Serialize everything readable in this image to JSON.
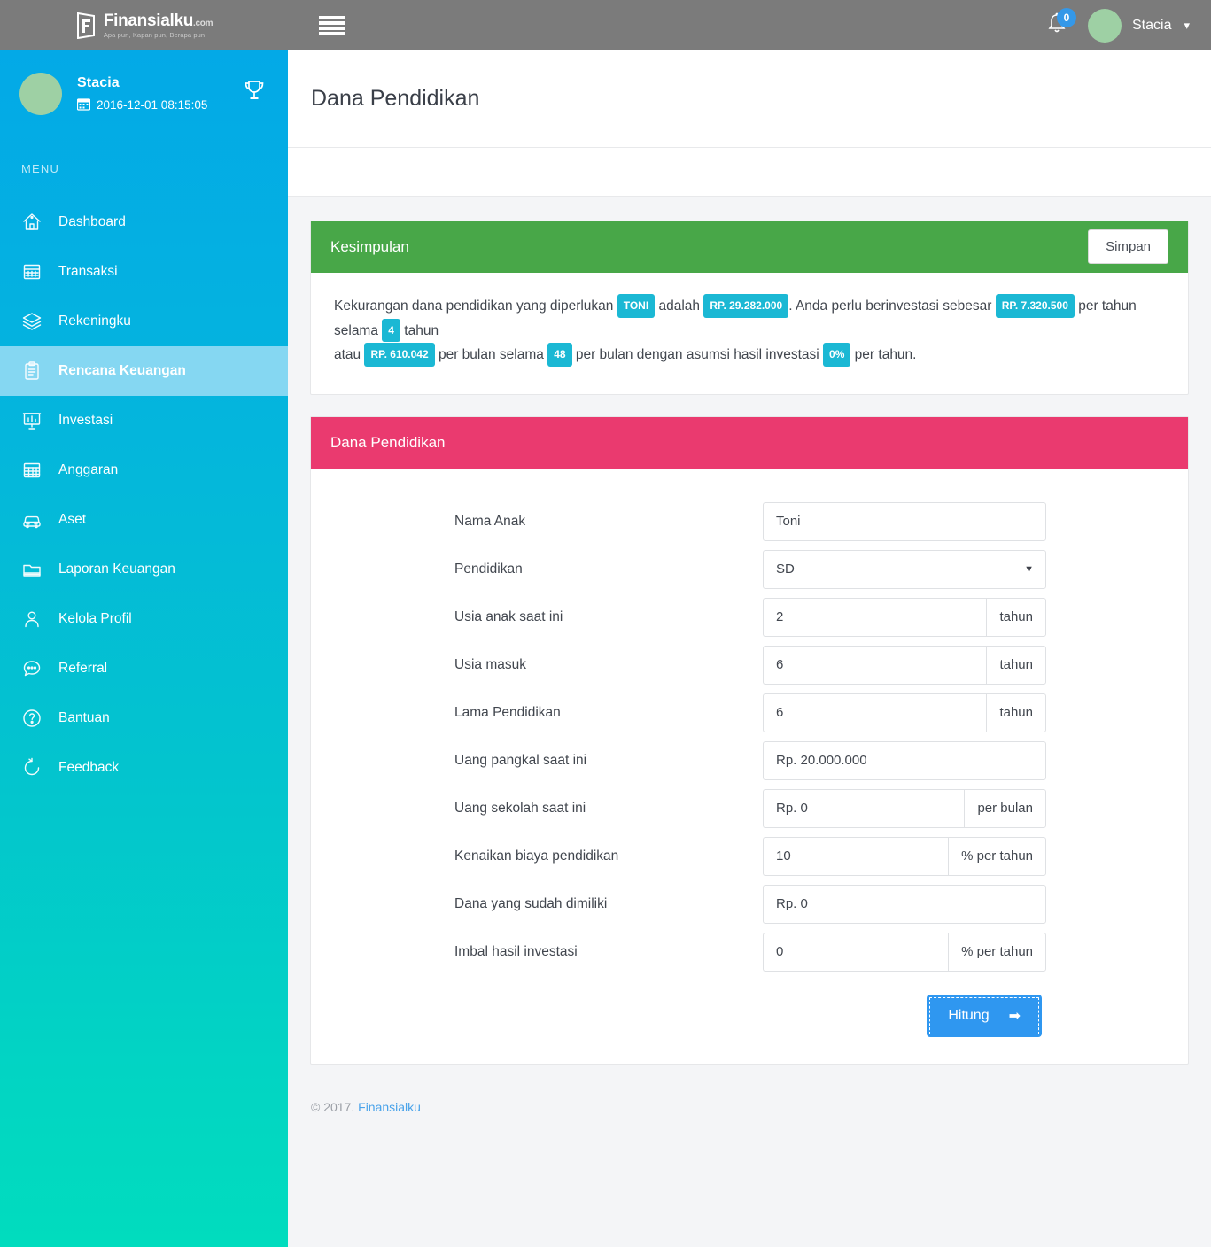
{
  "topbar": {
    "logo_title": "Finansialku",
    "logo_suffix": ".com",
    "logo_tagline": "Apa pun, Kapan pun, Berapa pun",
    "menu_toggle_name": "hamburger-menu",
    "notification_count": "0",
    "user_name": "Stacia",
    "caret": "⌄"
  },
  "sidebar": {
    "user_name": "Stacia",
    "user_datetime": "2016-12-01 08:15:05",
    "menu_label": "MENU",
    "items": [
      {
        "label": "Dashboard",
        "icon": "home-icon",
        "key": "dashboard",
        "active": false
      },
      {
        "label": "Transaksi",
        "icon": "calendar-icon",
        "key": "transaksi",
        "active": false
      },
      {
        "label": "Rekeningku",
        "icon": "layers-icon",
        "key": "rekeningku",
        "active": false
      },
      {
        "label": "Rencana Keuangan",
        "icon": "clipboard-icon",
        "key": "rencana-keuangan",
        "active": true
      },
      {
        "label": "Investasi",
        "icon": "chart-board-icon",
        "key": "investasi",
        "active": false
      },
      {
        "label": "Anggaran",
        "icon": "grid-icon",
        "key": "anggaran",
        "active": false
      },
      {
        "label": "Aset",
        "icon": "car-icon",
        "key": "aset",
        "active": false
      },
      {
        "label": "Laporan Keuangan",
        "icon": "folder-icon",
        "key": "laporan-keuangan",
        "active": false
      },
      {
        "label": "Kelola Profil",
        "icon": "user-icon",
        "key": "kelola-profil",
        "active": false
      },
      {
        "label": "Referral",
        "icon": "chat-icon",
        "key": "referral",
        "active": false
      },
      {
        "label": "Bantuan",
        "icon": "question-icon",
        "key": "bantuan",
        "active": false
      },
      {
        "label": "Feedback",
        "icon": "refresh-icon",
        "key": "feedback",
        "active": false
      }
    ]
  },
  "page": {
    "title": "Dana Pendidikan"
  },
  "summary": {
    "heading": "Kesimpulan",
    "save_label": "Simpan",
    "text_parts": {
      "p1": "Kekurangan dana pendidikan yang diperlukan ",
      "tag_child": "TONI",
      "p2": " adalah ",
      "tag_shortfall": "RP. 29.282.000",
      "p3": ". Anda perlu berinvestasi sebesar ",
      "tag_per_year": "RP. 7.320.500",
      "p4": " per tahun selama ",
      "tag_years": "4",
      "p5": " tahun",
      "p6": "atau ",
      "tag_per_month": "RP. 610.042",
      "p7": " per bulan selama ",
      "tag_months": "48",
      "p8": " per bulan dengan asumsi hasil investasi ",
      "tag_return": "0%",
      "p9": " per tahun."
    }
  },
  "form": {
    "heading": "Dana Pendidikan",
    "fields": [
      {
        "label": "Nama Anak",
        "type": "text",
        "value": "Toni",
        "addon": ""
      },
      {
        "label": "Pendidikan",
        "type": "select",
        "value": "SD",
        "addon": ""
      },
      {
        "label": "Usia anak saat ini",
        "type": "text",
        "value": "2",
        "addon": "tahun"
      },
      {
        "label": "Usia masuk",
        "type": "text",
        "value": "6",
        "addon": "tahun"
      },
      {
        "label": "Lama Pendidikan",
        "type": "text",
        "value": "6",
        "addon": "tahun"
      },
      {
        "label": "Uang pangkal saat ini",
        "type": "text",
        "value": "Rp. 20.000.000",
        "addon": ""
      },
      {
        "label": "Uang sekolah saat ini",
        "type": "text",
        "value": "Rp. 0",
        "addon": "per bulan"
      },
      {
        "label": "Kenaikan biaya pendidikan",
        "type": "text",
        "value": "10",
        "addon": "% per tahun"
      },
      {
        "label": "Dana yang sudah dimiliki",
        "type": "text",
        "value": "Rp. 0",
        "addon": ""
      },
      {
        "label": "Imbal hasil investasi",
        "type": "text",
        "value": "0",
        "addon": "% per tahun"
      }
    ],
    "submit_label": "Hitung",
    "submit_arrow": "➡"
  },
  "footer": {
    "copyright": "© 2017.",
    "link": "Finansialku"
  },
  "colors": {
    "topbar": "#7b7b7b",
    "sidebar_top": "#03a9e7",
    "sidebar_bottom": "#01dcbe",
    "sidebar_active": "#85d7f2",
    "summary_header": "#48a748",
    "form_header": "#ea3a6f",
    "tag": "#1bb8d4",
    "primary_button": "#2f97f0",
    "badge": "#3498e8",
    "link": "#4aa3ea"
  }
}
